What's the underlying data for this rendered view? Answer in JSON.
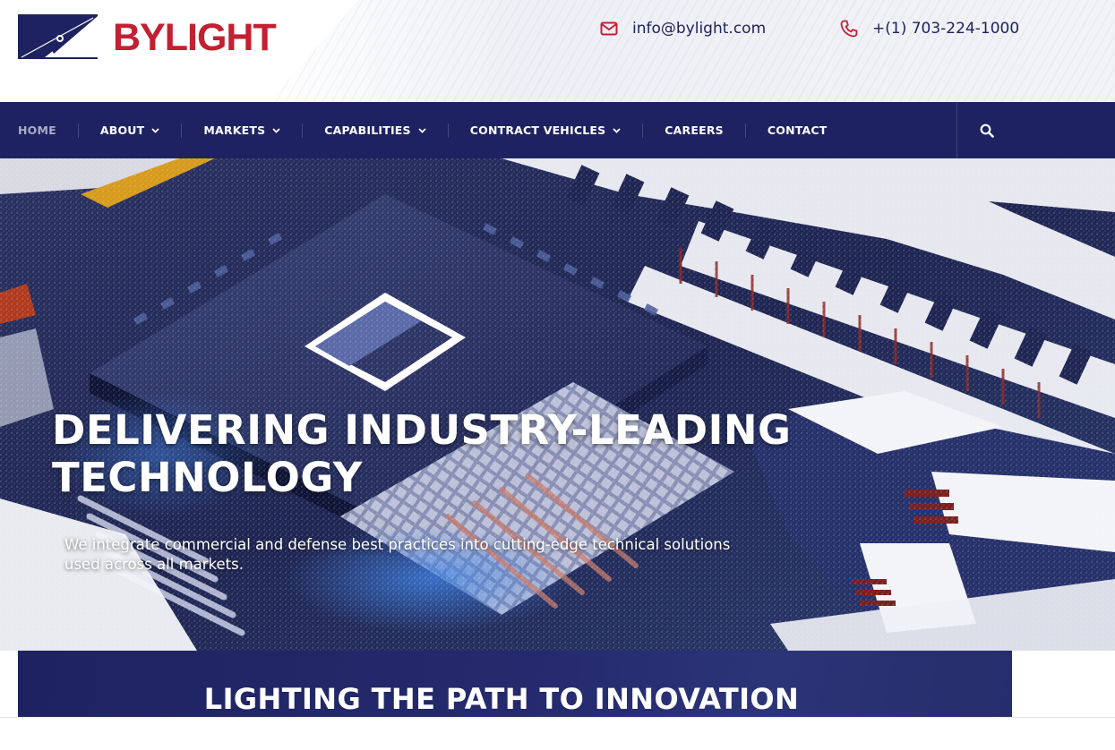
{
  "brand": {
    "name_part1": "BY",
    "name_part2": "LIGHT",
    "primary_color": "#1e2260",
    "accent_color": "#c32032"
  },
  "header": {
    "email": "info@bylight.com",
    "phone": "+(1) 703-224-1000",
    "email_icon": "envelope-icon",
    "phone_icon": "phone-icon"
  },
  "nav": {
    "items": [
      {
        "label": "HOME",
        "active": true,
        "has_dropdown": false
      },
      {
        "label": "ABOUT",
        "active": false,
        "has_dropdown": true
      },
      {
        "label": "MARKETS",
        "active": false,
        "has_dropdown": true
      },
      {
        "label": "CAPABILITIES",
        "active": false,
        "has_dropdown": true
      },
      {
        "label": "CONTRACT VEHICLES",
        "active": false,
        "has_dropdown": true
      },
      {
        "label": "CAREERS",
        "active": false,
        "has_dropdown": false
      },
      {
        "label": "CONTACT",
        "active": false,
        "has_dropdown": false
      }
    ],
    "search_icon": "search-icon"
  },
  "hero": {
    "title_line1": "DELIVERING INDUSTRY-LEADING",
    "title_line2": "TECHNOLOGY",
    "subtitle": "We integrate commercial and defense best practices into cutting-edge technical solutions used across all markets."
  },
  "banner": {
    "title": "LIGHTING THE PATH TO INNOVATION"
  }
}
